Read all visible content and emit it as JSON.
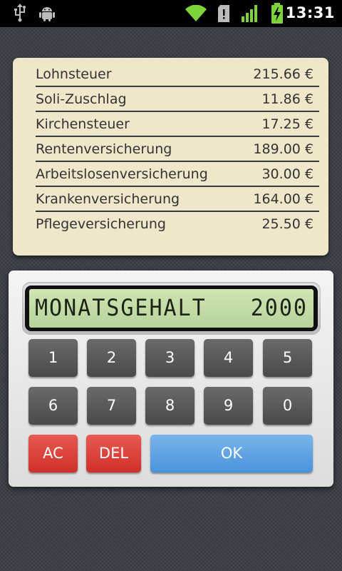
{
  "statusbar": {
    "time": "13:31",
    "icons": [
      "usb-icon",
      "android-debug-icon",
      "wifi-icon",
      "sd-card-alert-icon",
      "signal-icon",
      "battery-charging-icon"
    ]
  },
  "results": {
    "rows": [
      {
        "label": "Lohnsteuer",
        "value": "215.66 €"
      },
      {
        "label": "Soli-Zuschlag",
        "value": "11.86 €"
      },
      {
        "label": "Kirchensteuer",
        "value": "17.25 €"
      },
      {
        "label": "Rentenversicherung",
        "value": "189.00 €"
      },
      {
        "label": "Arbeitslosenversicherung",
        "value": "30.00 €"
      },
      {
        "label": "Krankenversicherung",
        "value": "164.00 €"
      },
      {
        "label": "Pflegeversicherung",
        "value": "25.50 €"
      }
    ]
  },
  "calculator": {
    "display_label": "MONATSGEHALT",
    "display_value": "2000",
    "keys_row1": [
      "1",
      "2",
      "3",
      "4",
      "5"
    ],
    "keys_row2": [
      "6",
      "7",
      "8",
      "9",
      "0"
    ],
    "ac_label": "AC",
    "del_label": "DEL",
    "ok_label": "OK",
    "colors": {
      "clear": "#d9372f",
      "ok": "#5a9fe2",
      "digit": "#555555",
      "lcd": "#c4dca8"
    }
  }
}
